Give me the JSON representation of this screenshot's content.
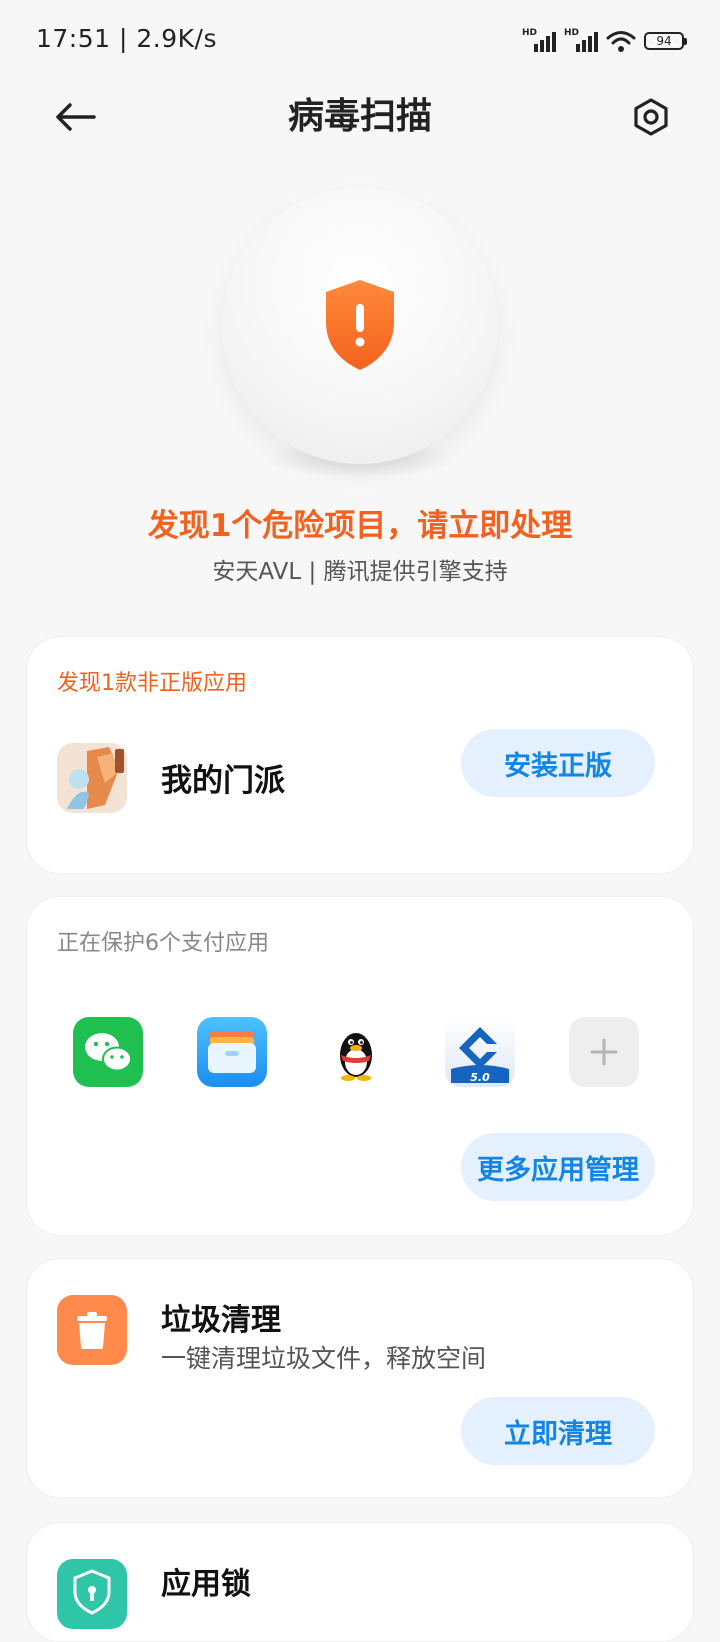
{
  "status_bar": {
    "time": "17:51 | 2.9K/s",
    "hd1": "HD",
    "hd2": "HD",
    "battery": "94"
  },
  "header": {
    "title": "病毒扫描"
  },
  "scan": {
    "warning": "发现1个危险项目，请立即处理",
    "engine": "安天AVL | 腾讯提供引擎支持",
    "accent_color": "#f2611d"
  },
  "pirated_card": {
    "heading": "发现1款非正版应用",
    "app_name": "我的门派",
    "button": "安装正版"
  },
  "payment_card": {
    "heading": "正在保护6个支付应用",
    "apps": [
      "wechat-icon",
      "wallet-icon",
      "qq-icon",
      "ccb-icon",
      "add-icon"
    ],
    "button": "更多应用管理"
  },
  "cleaner_card": {
    "title": "垃圾清理",
    "subtitle": "一键清理垃圾文件，释放空间",
    "button": "立即清理"
  },
  "applock_card": {
    "title": "应用锁"
  }
}
